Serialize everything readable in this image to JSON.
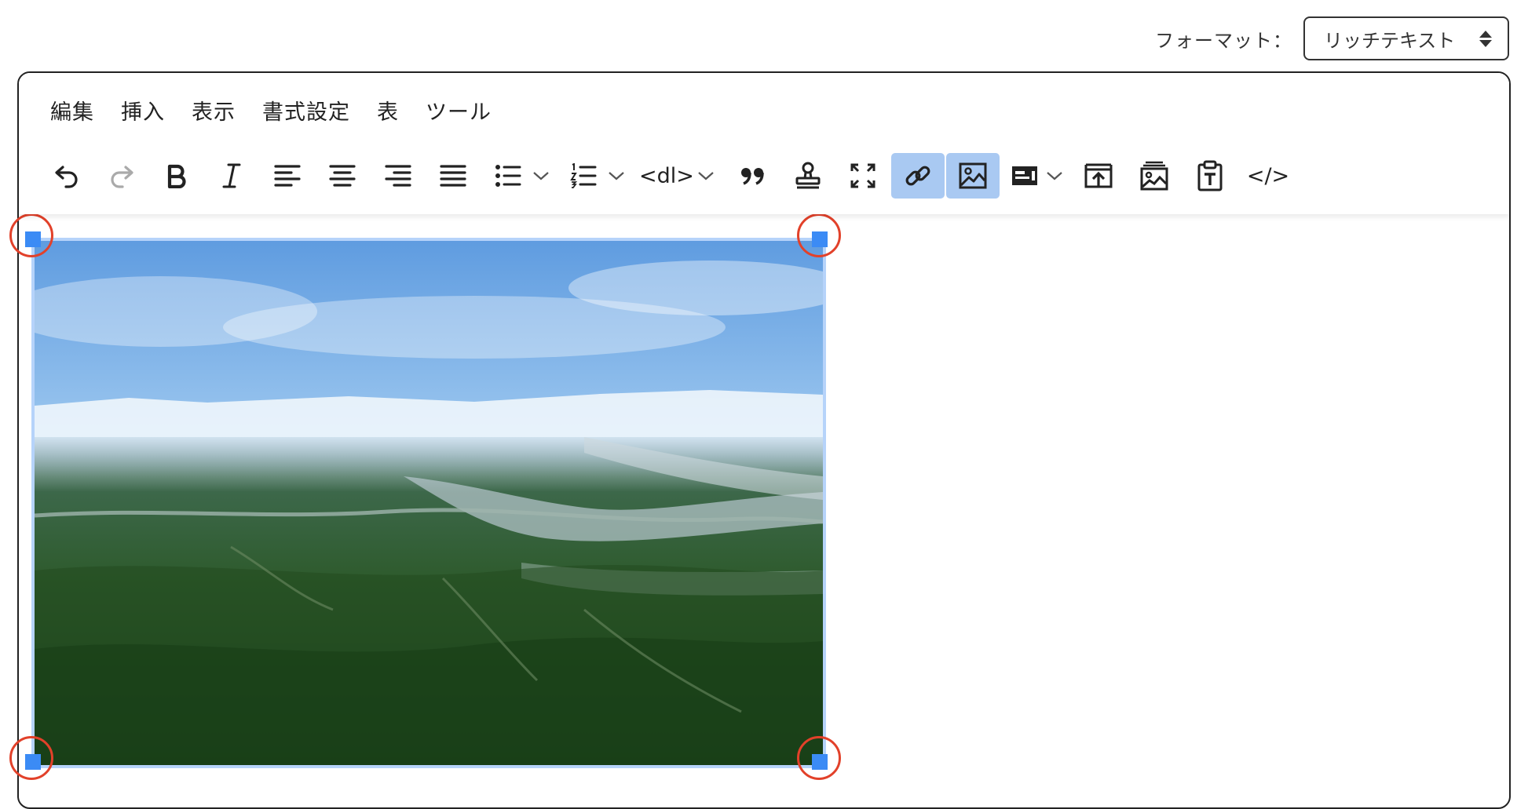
{
  "format": {
    "label": "フォーマット：",
    "selected": "リッチテキスト"
  },
  "menu": [
    "編集",
    "挿入",
    "表示",
    "書式設定",
    "表",
    "ツール"
  ],
  "toolbar": {
    "dl_label": "<dl>",
    "code_label": "</>",
    "buttons": [
      "undo-icon",
      "redo-icon",
      "bold-icon",
      "italic-icon",
      "align-left-icon",
      "align-center-icon",
      "align-right-icon",
      "justify-icon",
      "bullet-list-icon",
      "numbered-list-icon",
      "definition-list",
      "blockquote-icon",
      "stamp-icon",
      "fullscreen-icon",
      "link-icon",
      "image-icon",
      "media-icon",
      "upload-icon",
      "gallery-icon",
      "paste-text-icon",
      "source-code"
    ],
    "active": [
      "link-icon",
      "image-icon"
    ]
  },
  "colors": {
    "active_button": "#a9c9f2",
    "image_outline": "#b6d3fa",
    "handle": "#3b8bf5",
    "annotation_ring": "#e2412a"
  },
  "content": {
    "image": "aerial landscape photo of forested hills under blue sky",
    "selected": true
  }
}
